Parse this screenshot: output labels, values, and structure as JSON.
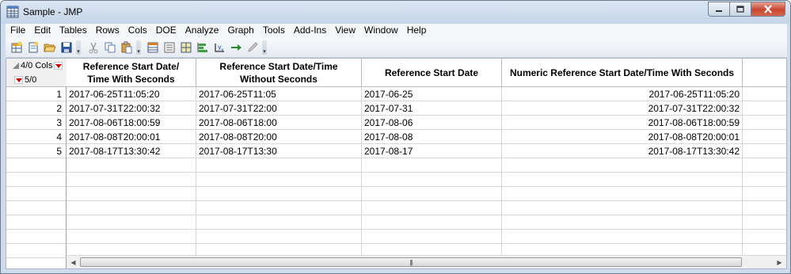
{
  "window": {
    "title": "Sample - JMP"
  },
  "menu": [
    "File",
    "Edit",
    "Tables",
    "Rows",
    "Cols",
    "DOE",
    "Analyze",
    "Graph",
    "Tools",
    "Add-Ins",
    "View",
    "Window",
    "Help"
  ],
  "toolbar": {
    "icons": [
      "new-data-table-icon",
      "new-script-icon",
      "open-icon",
      "save-icon",
      "cut-icon",
      "copy-icon",
      "paste-icon",
      "data-table-view-icon",
      "summary-icon",
      "grid-icon",
      "bar-chart-icon",
      "formula-icon",
      "run-script-icon",
      "edit-icon"
    ]
  },
  "table": {
    "cols_count": "4/0 Cols",
    "rows_count": "5/0",
    "headers": [
      [
        "Reference Start Date/",
        "Time With Seconds"
      ],
      [
        "Reference Start Date/Time",
        "Without Seconds"
      ],
      [
        "Reference Start Date"
      ],
      [
        "Numeric Reference Start Date/Time With Seconds"
      ]
    ],
    "rows": [
      [
        "1",
        "2017-06-25T11:05:20",
        "2017-06-25T11:05",
        "2017-06-25",
        "2017-06-25T11:05:20"
      ],
      [
        "2",
        "2017-07-31T22:00:32",
        "2017-07-31T22:00",
        "2017-07-31",
        "2017-07-31T22:00:32"
      ],
      [
        "3",
        "2017-08-06T18:00:59",
        "2017-08-06T18:00",
        "2017-08-06",
        "2017-08-06T18:00:59"
      ],
      [
        "4",
        "2017-08-08T20:00:01",
        "2017-08-08T20:00",
        "2017-08-08",
        "2017-08-08T20:00:01"
      ],
      [
        "5",
        "2017-08-17T13:30:42",
        "2017-08-17T13:30",
        "2017-08-17",
        "2017-08-17T13:30:42"
      ]
    ]
  }
}
